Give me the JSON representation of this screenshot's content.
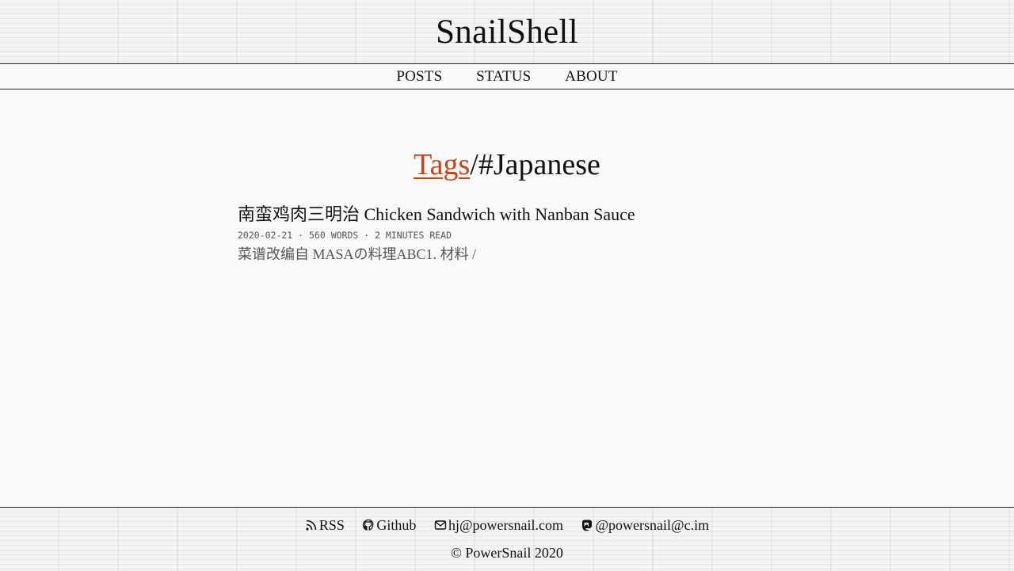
{
  "site": {
    "title": "SnailShell"
  },
  "nav": {
    "items": [
      {
        "label": "POSTS"
      },
      {
        "label": "STATUS"
      },
      {
        "label": "ABOUT"
      }
    ]
  },
  "heading": {
    "link_label": "Tags",
    "separator": "/",
    "tag": "#Japanese",
    "link_color": "#c2471b"
  },
  "posts": [
    {
      "title": "南蛮鸡肉三明治 Chicken Sandwich with Nanban Sauce",
      "meta": "2020-02-21 · 560 WORDS · 2 MINUTES READ",
      "excerpt": "菜谱改编自 MASAの料理ABC1. 材料 /"
    }
  ],
  "footer": {
    "links": [
      {
        "label": "RSS",
        "icon": "rss-icon"
      },
      {
        "label": "Github",
        "icon": "github-icon"
      },
      {
        "label": "hj@powersnail.com",
        "icon": "mail-icon"
      },
      {
        "label": "@powersnail@c.im",
        "icon": "mastodon-icon"
      }
    ],
    "copyright": "© PowerSnail 2020"
  }
}
